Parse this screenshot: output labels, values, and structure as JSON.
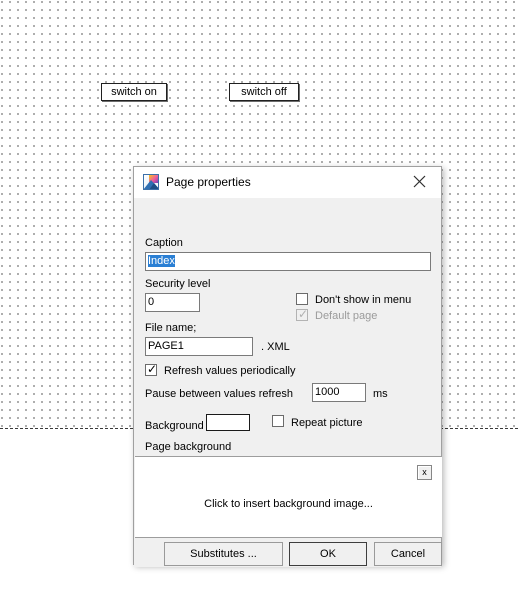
{
  "canvas": {
    "buttons": [
      {
        "label": "switch on"
      },
      {
        "label": "switch off"
      }
    ]
  },
  "dialog": {
    "title": "Page properties",
    "icon": "picture-icon",
    "close_label": "✕",
    "caption": {
      "label": "Caption",
      "value": "Index",
      "selected": true
    },
    "security_level": {
      "label": "Security level",
      "value": "0"
    },
    "dont_show_in_menu": {
      "label": "Don't show in menu",
      "checked": false
    },
    "default_page": {
      "label": "Default page",
      "checked": true,
      "disabled": true
    },
    "file_name": {
      "label": "File name;",
      "value": "PAGE1",
      "extension": ". XML"
    },
    "refresh_periodically": {
      "label": "Refresh values periodically",
      "checked": true
    },
    "pause_refresh": {
      "label": "Pause between values refresh",
      "value": "1000",
      "unit": "ms"
    },
    "background": {
      "label": "Background",
      "color": "#ffffff"
    },
    "repeat_picture": {
      "label": "Repeat picture",
      "checked": false
    },
    "page_background": {
      "label": "Page background",
      "hint": "Click to insert background image...",
      "clear_label": "x"
    },
    "buttons": {
      "substitutes": "Substitutes ...",
      "ok": "OK",
      "cancel": "Cancel"
    }
  },
  "colors": {
    "selection": "#2a7fd4",
    "dialog_face": "#f0f0f0",
    "text": "#000000",
    "disabled_text": "#9b9b9b"
  }
}
